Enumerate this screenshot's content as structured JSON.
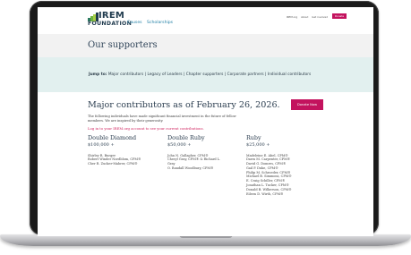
{
  "logo": {
    "line1": "IREM",
    "line2": "FOUNDATION",
    "colors": [
      "#1f3a4d",
      "#2e7d62",
      "#6db33f",
      "#a8cf45"
    ]
  },
  "main_nav": [
    "Causes",
    "Scholarships"
  ],
  "util_nav": [
    "IREM.org",
    "About",
    "Get involved"
  ],
  "header_donate": "Donate",
  "page_title": "Our supporters",
  "jump": {
    "label": "Jump to:",
    "links": [
      "Major contributors",
      "Legacy of Leaders",
      "Chapter supporters",
      "Corporate partners",
      "Individual contributors"
    ]
  },
  "major": {
    "title": "Major contributors as of February 26, 2026.",
    "donate_label": "Donate Now",
    "intro": "The following individuals have made significant financial investment in the future of fellow members. We are inspired by their generosity.",
    "login_link": "Log in to your IREM.org account to see your current contributions."
  },
  "columns": [
    {
      "title": "Double Diamond",
      "amount": "$100,000 +",
      "names": [
        "Shirley R. Burger",
        "Robert Winder Nordblom, CPM®",
        "Cher R. Zucker-Mahrer, CPM®"
      ]
    },
    {
      "title": "Double Ruby",
      "amount": "$50,000 +",
      "names": [
        "John N. Gallagher, CPM®",
        "Cheryl Gray, CPM® & Richard L.",
        "Gray",
        "O. Randall Woodbury, CPM®"
      ]
    },
    {
      "title": "Ruby",
      "amount": "$25,000 +",
      "names": [
        "Madeleine E. Abel, CPM®",
        "Dawn M. Carpenter, CPM®",
        "David G. Domres, CPM®",
        "Gail P. Duke, CPM®",
        "Philip M. Schroeder, CPM®",
        "Michael B. Simmons, CPM®",
        "E. Craig Schiller, CPM®",
        "Jonathan L. Tucker, CPM®",
        "Donald B. Wilkerson, CPM®",
        "Eileen D. Wirth, CPM®"
      ]
    }
  ]
}
